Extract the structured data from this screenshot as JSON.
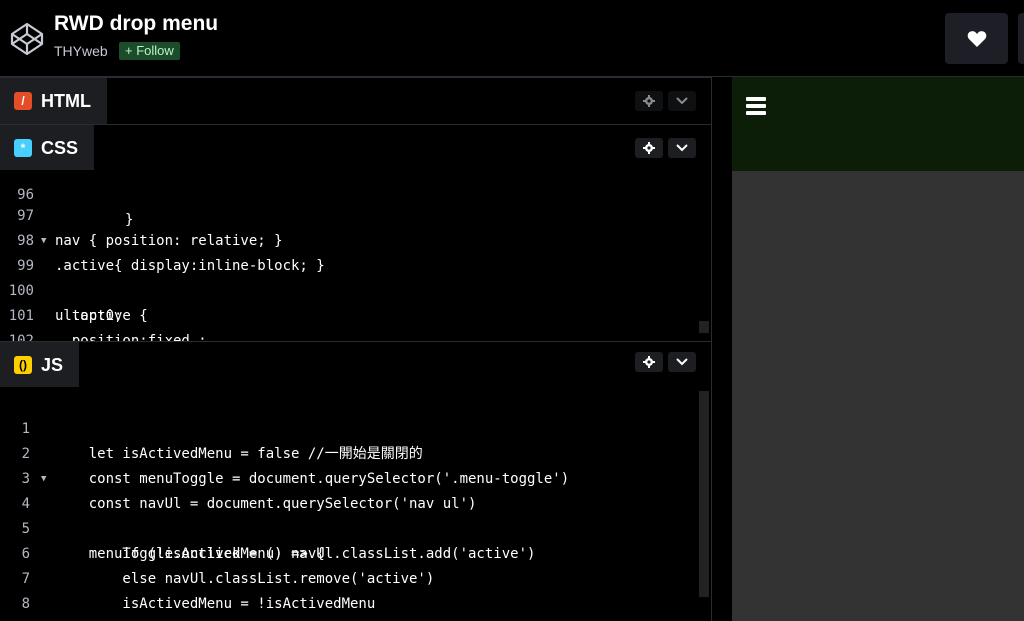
{
  "header": {
    "title": "RWD drop menu",
    "author": "THYweb",
    "follow_label": "+ Follow"
  },
  "icons": {
    "logo": "codepen-logo-icon",
    "heart": "heart-icon",
    "settings": "gear-icon",
    "collapse": "chevron-down-icon",
    "menu": "hamburger-menu-icon"
  },
  "colors": {
    "html_accent": "#e44d26",
    "css_accent": "#47cfff",
    "js_accent": "#fcd000",
    "preview_nav": "#0d1e08",
    "preview_bg": "#333333"
  },
  "html_panel": {
    "label": "HTML"
  },
  "css_panel": {
    "label": "CSS",
    "lines": [
      {
        "num": "96",
        "text": "}"
      },
      {
        "num": "97",
        "text": "nav { position: relative; }"
      },
      {
        "num": "98",
        "text": ".active{ display:inline-block; }"
      },
      {
        "num": "99",
        "text": "ul.active {"
      },
      {
        "num": "100",
        "text": "  top:0;"
      },
      {
        "num": "101",
        "text": "  position:fixed ;"
      },
      {
        "num": "102",
        "text": "}"
      }
    ]
  },
  "js_panel": {
    "label": "JS",
    "lines": [
      {
        "num": "1",
        "text": "    let isActivedMenu = false //一開始是關閉的"
      },
      {
        "num": "2",
        "text": "    const menuToggle = document.querySelector('.menu-toggle')"
      },
      {
        "num": "3",
        "text": "    const navUl = document.querySelector('nav ul')"
      },
      {
        "num": "4",
        "text": "    menuToggle.onclick = () => {"
      },
      {
        "num": "5",
        "text": "        if (!isActivedMenu) navUl.classList.add('active')"
      },
      {
        "num": "6",
        "text": "        else navUl.classList.remove('active')"
      },
      {
        "num": "7",
        "text": "        isActivedMenu = !isActivedMenu"
      },
      {
        "num": "8",
        "text": "    }"
      }
    ]
  }
}
